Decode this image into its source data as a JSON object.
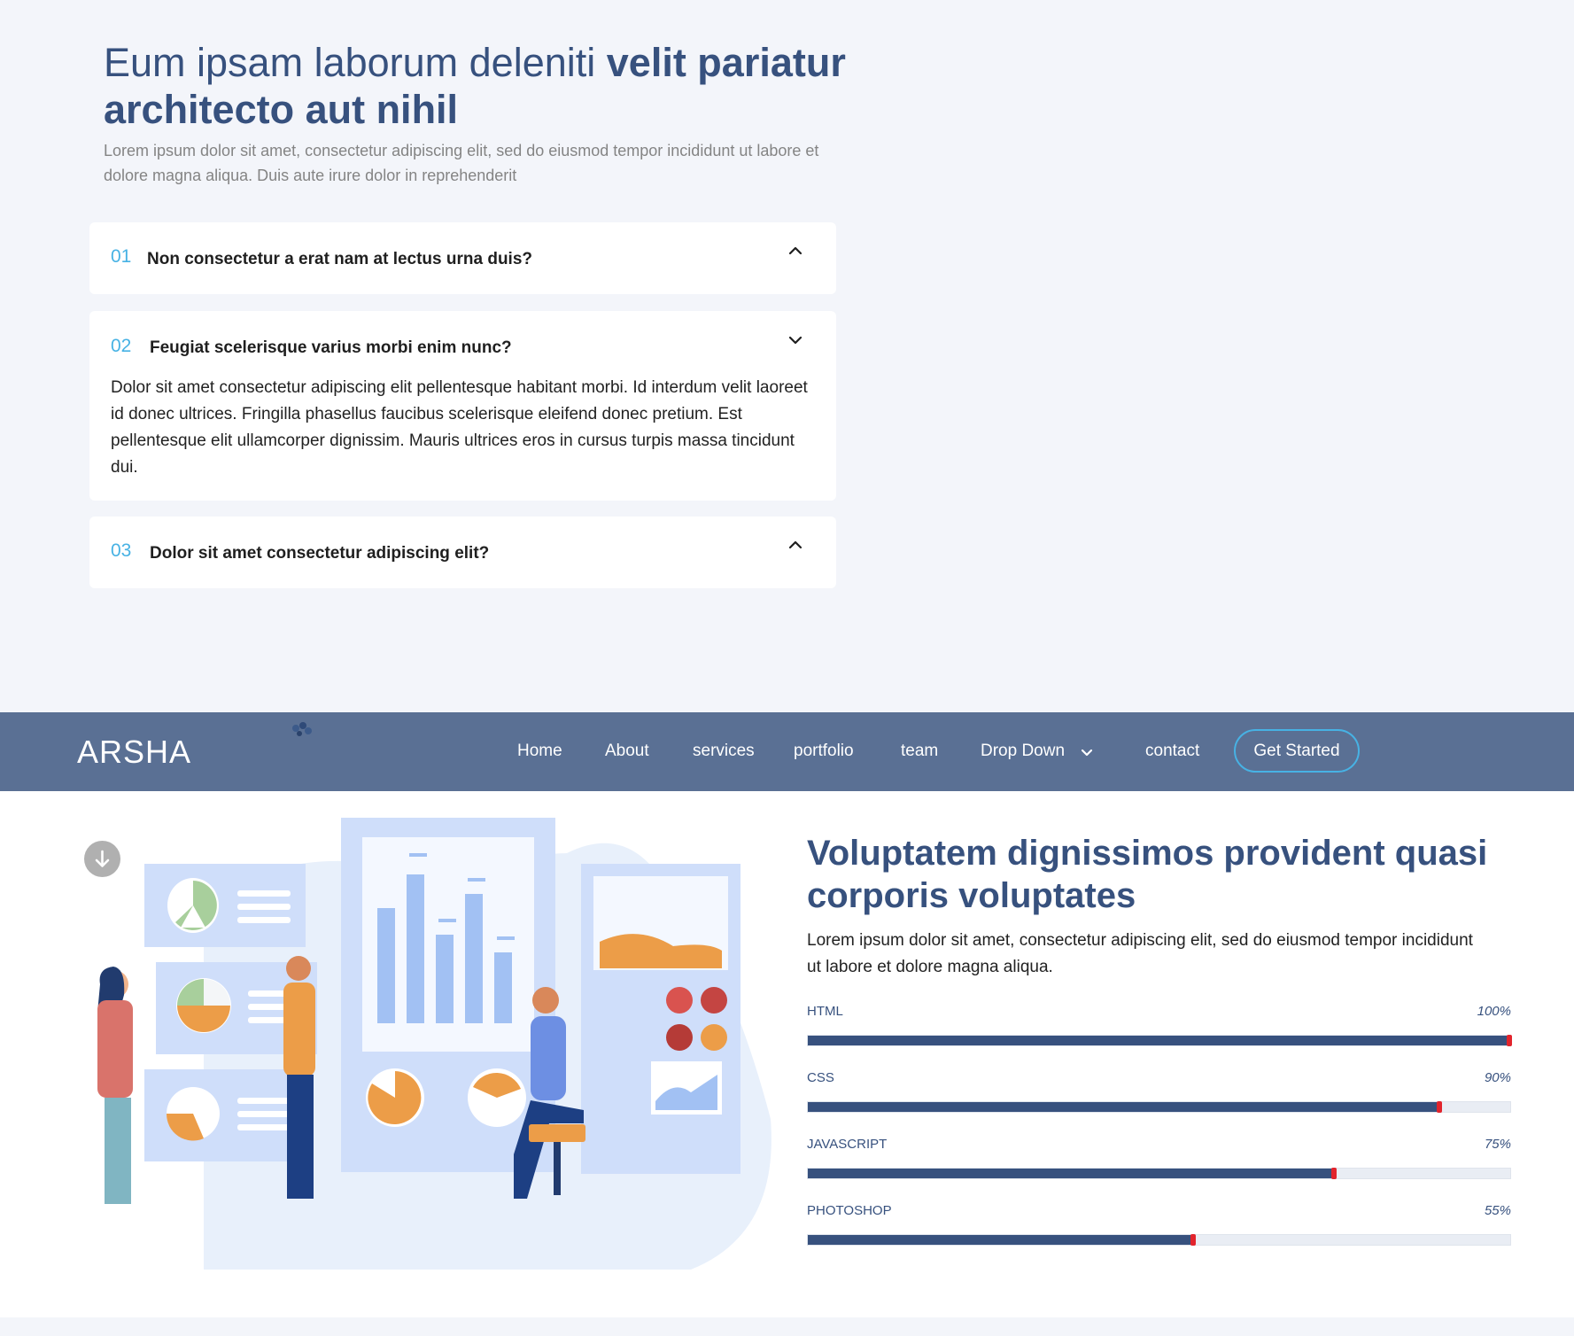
{
  "faq": {
    "title_light": "Eum ipsam laborum deleniti ",
    "title_bold_1": "velit pariatur",
    "title_bold_2": "architecto aut nihil",
    "description": "Lorem ipsum dolor sit amet, consectetur adipiscing elit, sed do eiusmod tempor incididunt ut labore et dolore magna aliqua. Duis aute irure dolor in reprehenderit",
    "items": [
      {
        "num": "01",
        "question": "Non consectetur a erat nam at lectus urna duis?",
        "chevron": "chevron-up"
      },
      {
        "num": "02",
        "question": "Feugiat scelerisque varius morbi enim nunc?",
        "chevron": "chevron-down",
        "answer": "Dolor sit amet consectetur adipiscing elit pellentesque habitant morbi. Id interdum velit laoreet id donec ultrices. Fringilla phasellus faucibus scelerisque eleifend donec pretium. Est pellentesque elit ullamcorper dignissim. Mauris ultrices eros in cursus turpis massa tincidunt dui."
      },
      {
        "num": "03",
        "question": "Dolor sit amet consectetur adipiscing elit?",
        "chevron": "chevron-up"
      }
    ]
  },
  "header": {
    "logo": "ARSHA",
    "nav": [
      "Home",
      "About",
      "services",
      "portfolio",
      "team",
      "Drop Down",
      "contact"
    ],
    "cta": "Get Started"
  },
  "skills": {
    "title": "Voluptatem dignissimos provident quasi corporis voluptates",
    "description": "Lorem ipsum dolor sit amet, consectetur adipiscing elit, sed do eiusmod tempor incididunt ut labore et dolore magna aliqua.",
    "items": [
      {
        "name": "HTML",
        "value": "100%",
        "percent": 100
      },
      {
        "name": "CSS",
        "value": "90%",
        "percent": 90
      },
      {
        "name": "JAVASCRIPT",
        "value": "75%",
        "percent": 75
      },
      {
        "name": "PHOTOSHOP",
        "value": "55%",
        "percent": 55
      }
    ]
  },
  "colors": {
    "primary": "#37517e",
    "accent": "#47b2e4",
    "header_bg": "#5a7094",
    "bar_tip": "#e2242c"
  },
  "icons": {
    "scroll_down": "arrow-down-circle-icon",
    "dropdown": "chevron-down-icon"
  }
}
